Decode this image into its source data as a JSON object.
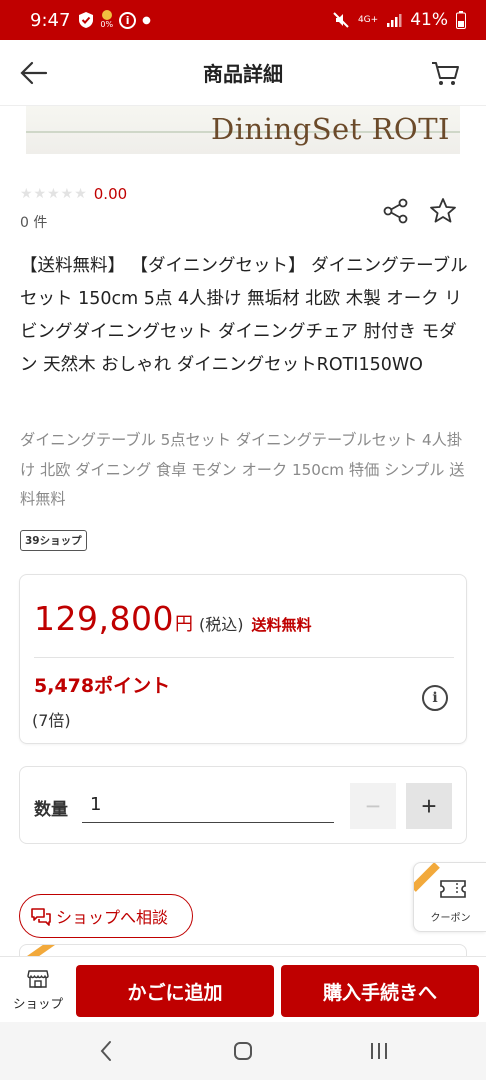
{
  "status_bar": {
    "time": "9:47",
    "battery": "41%",
    "network": "4G+",
    "notification_small": "0%"
  },
  "header": {
    "title": "商品詳細"
  },
  "hero": {
    "brand_text": "DiningSet ROTI"
  },
  "rating": {
    "stars": "★★★★★",
    "score": "0.00",
    "review_count": "0 件",
    "value": 0
  },
  "product": {
    "title": "【送料無料】 【ダイニングセット】 ダイニングテーブルセット 150cm 5点 4人掛け 無垢材 北欧 木製 オーク リビングダイニングセット ダイニングチェア 肘付き モダン 天然木 おしゃれ ダイニングセットROTI150WO",
    "subtitle": "ダイニングテーブル 5点セット ダイニングテーブルセット 4人掛け 北欧 ダイニング 食卓 モダン オーク 150cm 特価 シンプル 送料無料",
    "shop_tag": "39ショップ"
  },
  "price": {
    "amount": "129,800",
    "yen": "円",
    "tax": "(税込)",
    "shipping": "送料無料",
    "points": "5,478ポイント",
    "multiplier": "(7倍)",
    "info": "i"
  },
  "quantity": {
    "label": "数量",
    "value": "1",
    "minus": "−",
    "plus": "+"
  },
  "coupon": {
    "label": "クーポン"
  },
  "consult": {
    "label": "ショップへ相談"
  },
  "actions": {
    "shop_label": "ショップ",
    "add_to_cart": "かごに追加",
    "checkout": "購入手続きへ"
  },
  "colors": {
    "brand_red": "#bf0000",
    "status_bar": "#c00000",
    "ribbon": "#f2a93b"
  }
}
